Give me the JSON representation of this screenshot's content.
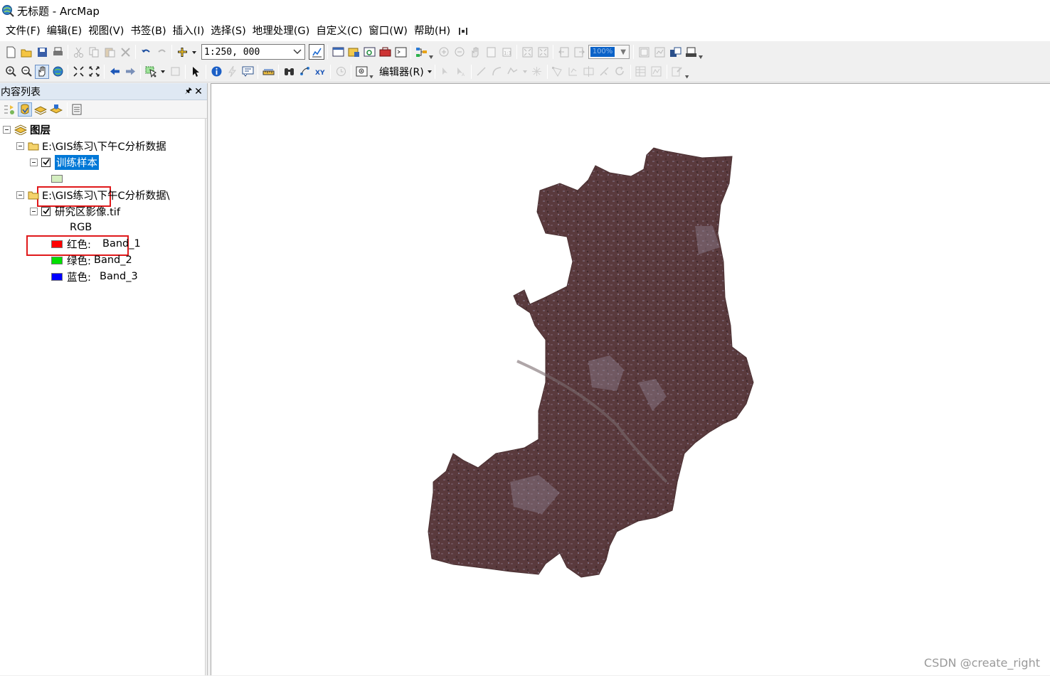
{
  "window": {
    "title": "无标题 - ArcMap"
  },
  "menu": [
    "文件(F)",
    "编辑(E)",
    "视图(V)",
    "书签(B)",
    "插入(I)",
    "选择(S)",
    "地理处理(G)",
    "自定义(C)",
    "窗口(W)",
    "帮助(H)"
  ],
  "toolbar": {
    "scale_value": "1:250, 000",
    "zoom_value": "100%",
    "editor_label": "编辑器(R)"
  },
  "toc": {
    "title": "内容列表",
    "root_label": "图层",
    "group1_path": "E:\\GIS练习\\下午C分析数据",
    "layer1_label": "训练样本",
    "group2_path": "E:\\GIS练习\\下午C分析数据\\",
    "layer2_label": "研究区影像.tif",
    "rgb_label": "RGB",
    "bands": [
      {
        "channel": "红色:",
        "band": "Band_1",
        "color": "#ff0000"
      },
      {
        "channel": "绿色:",
        "band": "Band_2",
        "color": "#00e000"
      },
      {
        "channel": "蓝色:",
        "band": "Band_3",
        "color": "#0000ff"
      }
    ],
    "sample_swatch_color": "#d4eec0"
  },
  "map": {
    "raster_color": "#5e3e40",
    "watermark": "CSDN @create_right"
  },
  "colors": {
    "selection": "#0078d7",
    "highlight_box": "#e0191b"
  }
}
